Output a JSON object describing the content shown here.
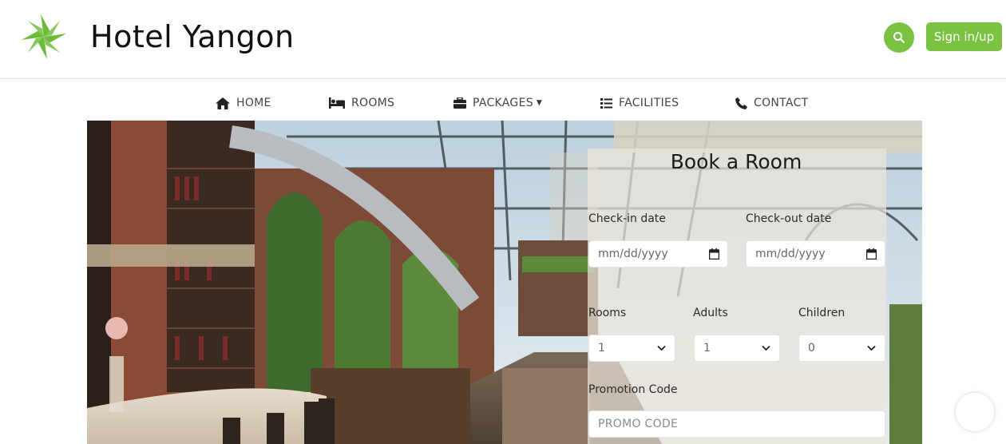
{
  "header": {
    "brand_name": "Hotel Yangon",
    "signin_label": "Sign in/up",
    "accent_color": "#7bc142"
  },
  "nav": {
    "items": [
      {
        "label": "HOME",
        "icon": "home-icon"
      },
      {
        "label": "ROOMS",
        "icon": "bed-icon"
      },
      {
        "label": "PACKAGES",
        "icon": "briefcase-icon",
        "has_dropdown": true
      },
      {
        "label": "FACILITIES",
        "icon": "list-icon"
      },
      {
        "label": "CONTACT",
        "icon": "phone-icon"
      }
    ]
  },
  "booking": {
    "title": "Book a Room",
    "checkin_label": "Check-in date",
    "checkin_placeholder": "mm/dd/yyyy",
    "checkout_label": "Check-out date",
    "checkout_placeholder": "mm/dd/yyyy",
    "rooms_label": "Rooms",
    "rooms_value": "1",
    "adults_label": "Adults",
    "adults_value": "1",
    "children_label": "Children",
    "children_value": "0",
    "promo_label": "Promotion Code",
    "promo_placeholder": "PROMO CODE"
  }
}
